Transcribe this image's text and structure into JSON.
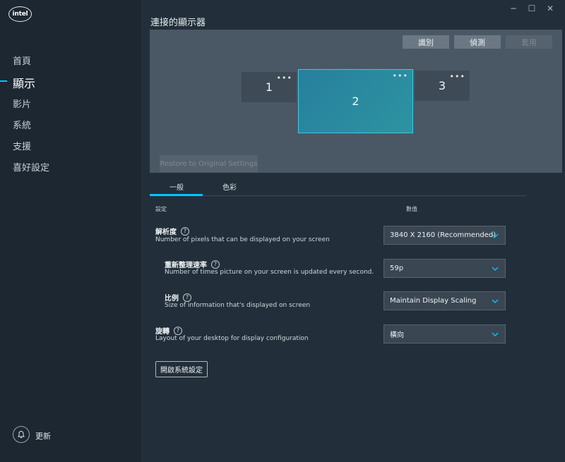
{
  "sidebar": {
    "logo": "intel",
    "items": [
      {
        "label": "首頁"
      },
      {
        "label": "顯示"
      },
      {
        "label": "影片"
      },
      {
        "label": "系統"
      },
      {
        "label": "支援"
      },
      {
        "label": "喜好設定"
      }
    ],
    "active_index": 1,
    "update_label": "更新",
    "update_icon": "bell-icon"
  },
  "window": {
    "minimize": "─",
    "maximize": "☐",
    "close": "✕"
  },
  "displays": {
    "title": "連接的顯示器",
    "identify_label": "識別",
    "detect_label": "偵測",
    "apply_label": "套用",
    "restore_label": "Restore to Original Settings",
    "monitors": [
      {
        "number": "1",
        "menu": "•••"
      },
      {
        "number": "2",
        "menu": "•••"
      },
      {
        "number": "3",
        "menu": "•••"
      }
    ],
    "selected_monitor": "2"
  },
  "tabs": {
    "general": "一般",
    "color": "色彩"
  },
  "table": {
    "settings_header": "設定",
    "value_header": "數值"
  },
  "settings": {
    "resolution": {
      "title": "解析度",
      "desc": "Number of pixels that can be displayed on your screen",
      "value": "3840 X 2160 (Recommended)"
    },
    "refresh": {
      "title": "重新整理速率",
      "desc": "Number of times picture on your screen is updated every second.",
      "value": "59p"
    },
    "scale": {
      "title": "比例",
      "desc": "Size of information that's displayed on screen",
      "value": "Maintain Display Scaling"
    },
    "rotation": {
      "title": "旋轉",
      "desc": "Layout of your desktop for display configuration",
      "value": "橫向"
    },
    "help_glyph": "?"
  },
  "system_settings_label": "開啟系統設定",
  "colors": {
    "accent": "#00c7fd",
    "selected_monitor": "#2a8aa0",
    "panel": "#4a5866"
  }
}
